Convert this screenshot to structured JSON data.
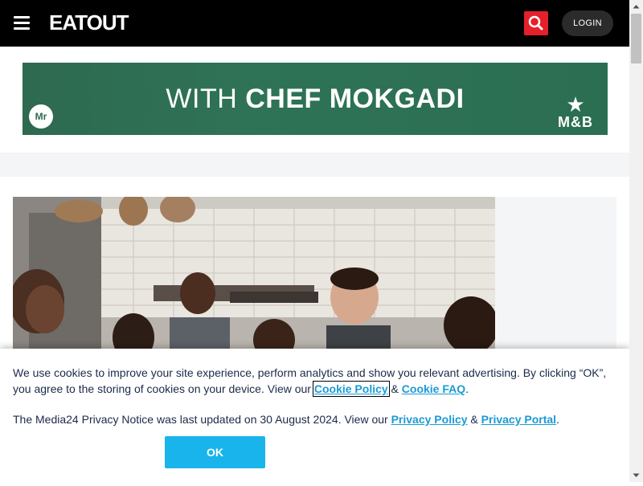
{
  "header": {
    "logo": "EATOUT",
    "login_label": "LOGIN",
    "menu_icon": "hamburger-menu-icon",
    "search_icon": "search-icon",
    "accent_color": "#e4202a"
  },
  "ad": {
    "prefix": "WITH ",
    "headline": "CHEF MOKGADI",
    "badge": "Mr",
    "brand": "M&B",
    "brand_icon": "star-icon"
  },
  "cookie": {
    "text1": "We use cookies to improve your site experience, perform analytics and show you relevant advertising. By clicking “OK”, you agree to the storing of cookies on your device. View our ",
    "link1": "Cookie Policy",
    "sep1": " & ",
    "link2": "Cookie FAQ",
    "end1": ".",
    "text2": "The Media24 Privacy Notice was last updated on 30 August 2024. View our ",
    "link3": "Privacy Policy",
    "sep2": " & ",
    "link4": "Privacy Portal",
    "end2": ".",
    "ok_label": "OK",
    "link_color": "#1b9ad6",
    "button_color": "#19b4eb"
  }
}
